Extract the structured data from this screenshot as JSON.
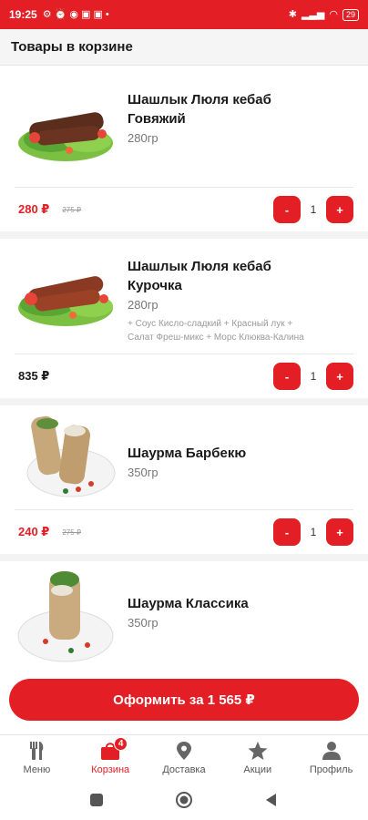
{
  "status_bar": {
    "time": "19:25",
    "battery": "29"
  },
  "header": {
    "title": "Товары в корзине"
  },
  "cart": {
    "items": [
      {
        "name_line1": "Шашлык Люля кебаб",
        "name_line2": "Говяжий",
        "weight": "280гр",
        "modifiers_line1": "",
        "modifiers_line2": "",
        "price": "280 ₽",
        "old_price": "275 ₽",
        "quantity": "1",
        "minus_label": "-",
        "plus_label": "+"
      },
      {
        "name_line1": "Шашлык Люля кебаб",
        "name_line2": "Курочка",
        "weight": "280гр",
        "modifiers_line1": "+ Соус Кисло-сладкий + Красный лук +",
        "modifiers_line2": "Салат Фреш-микс + Морс Клюква-Калина",
        "price": "835 ₽",
        "old_price": "",
        "quantity": "1",
        "minus_label": "-",
        "plus_label": "+"
      },
      {
        "name_line1": "Шаурма Барбекю",
        "name_line2": "",
        "weight": "350гр",
        "modifiers_line1": "",
        "modifiers_line2": "",
        "price": "240 ₽",
        "old_price": "275 ₽",
        "quantity": "1",
        "minus_label": "-",
        "plus_label": "+"
      },
      {
        "name_line1": "Шаурма Классика",
        "name_line2": "",
        "weight": "350гр",
        "modifiers_line1": "",
        "modifiers_line2": "",
        "price": "",
        "old_price": "",
        "quantity": "",
        "minus_label": "",
        "plus_label": ""
      }
    ]
  },
  "checkout": {
    "label": "Оформить за 1 565 ₽"
  },
  "bottom_nav": {
    "items": [
      {
        "label": "Меню",
        "icon": "fork-knife-icon"
      },
      {
        "label": "Корзина",
        "icon": "cart-bag-icon",
        "badge": "4",
        "active": true
      },
      {
        "label": "Доставка",
        "icon": "map-pin-icon"
      },
      {
        "label": "Акции",
        "icon": "star-icon"
      },
      {
        "label": "Профиль",
        "icon": "user-icon"
      }
    ]
  },
  "colors": {
    "accent": "#e31e24",
    "text": "#1a1a1a",
    "muted": "#777777"
  }
}
